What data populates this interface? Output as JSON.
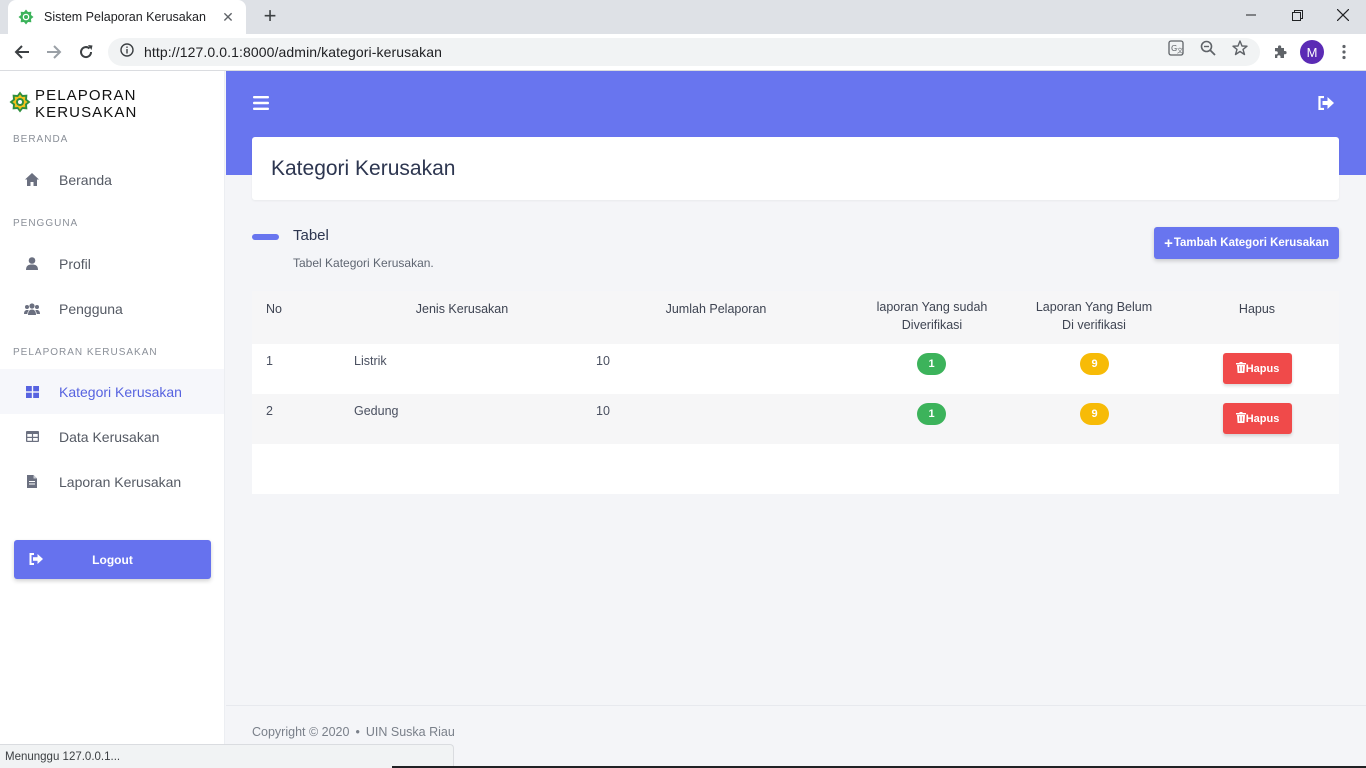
{
  "browser": {
    "tab_title": "Sistem Pelaporan Kerusakan",
    "url": "http://127.0.0.1:8000/admin/kategori-kerusakan",
    "profile_initial": "M",
    "status_text": "Menunggu 127.0.0.1..."
  },
  "sidebar": {
    "brand": "PELAPORAN KERUSAKAN",
    "sections": {
      "beranda": "BERANDA",
      "pengguna": "PENGGUNA",
      "pelaporan": "PELAPORAN KERUSAKAN"
    },
    "items": [
      {
        "label": "Beranda",
        "icon": "home-icon"
      },
      {
        "label": "Profil",
        "icon": "user-icon"
      },
      {
        "label": "Pengguna",
        "icon": "users-icon"
      },
      {
        "label": "Kategori Kerusakan",
        "icon": "grid-icon",
        "active": true
      },
      {
        "label": "Data Kerusakan",
        "icon": "table-icon"
      },
      {
        "label": "Laporan Kerusakan",
        "icon": "file-icon"
      }
    ],
    "logout_label": "Logout"
  },
  "main": {
    "page_title": "Kategori Kerusakan",
    "table_heading": "Tabel",
    "table_subtitle": "Tabel Kategori Kerusakan.",
    "add_button_label": "Tambah Kategori Kerusakan",
    "columns": {
      "no": "No",
      "jenis": "Jenis Kerusakan",
      "jumlah": "Jumlah Pelaporan",
      "verified_1": "laporan Yang sudah",
      "verified_2": "Diverifikasi",
      "unverified_1": "Laporan Yang Belum",
      "unverified_2": "Di verifikasi",
      "hapus": "Hapus"
    },
    "rows": [
      {
        "no": "1",
        "jenis": "Listrik",
        "jumlah": "10",
        "verified": "1",
        "unverified": "9",
        "delete_label": "Hapus"
      },
      {
        "no": "2",
        "jenis": "Gedung",
        "jumlah": "10",
        "verified": "1",
        "unverified": "9",
        "delete_label": "Hapus"
      }
    ]
  },
  "footer": {
    "copyright": "Copyright © 2020",
    "org": "UIN Suska Riau"
  },
  "colors": {
    "primary": "#6875ef",
    "success": "#3cb35b",
    "warning": "#f7bb07",
    "danger": "#f04a4a"
  }
}
